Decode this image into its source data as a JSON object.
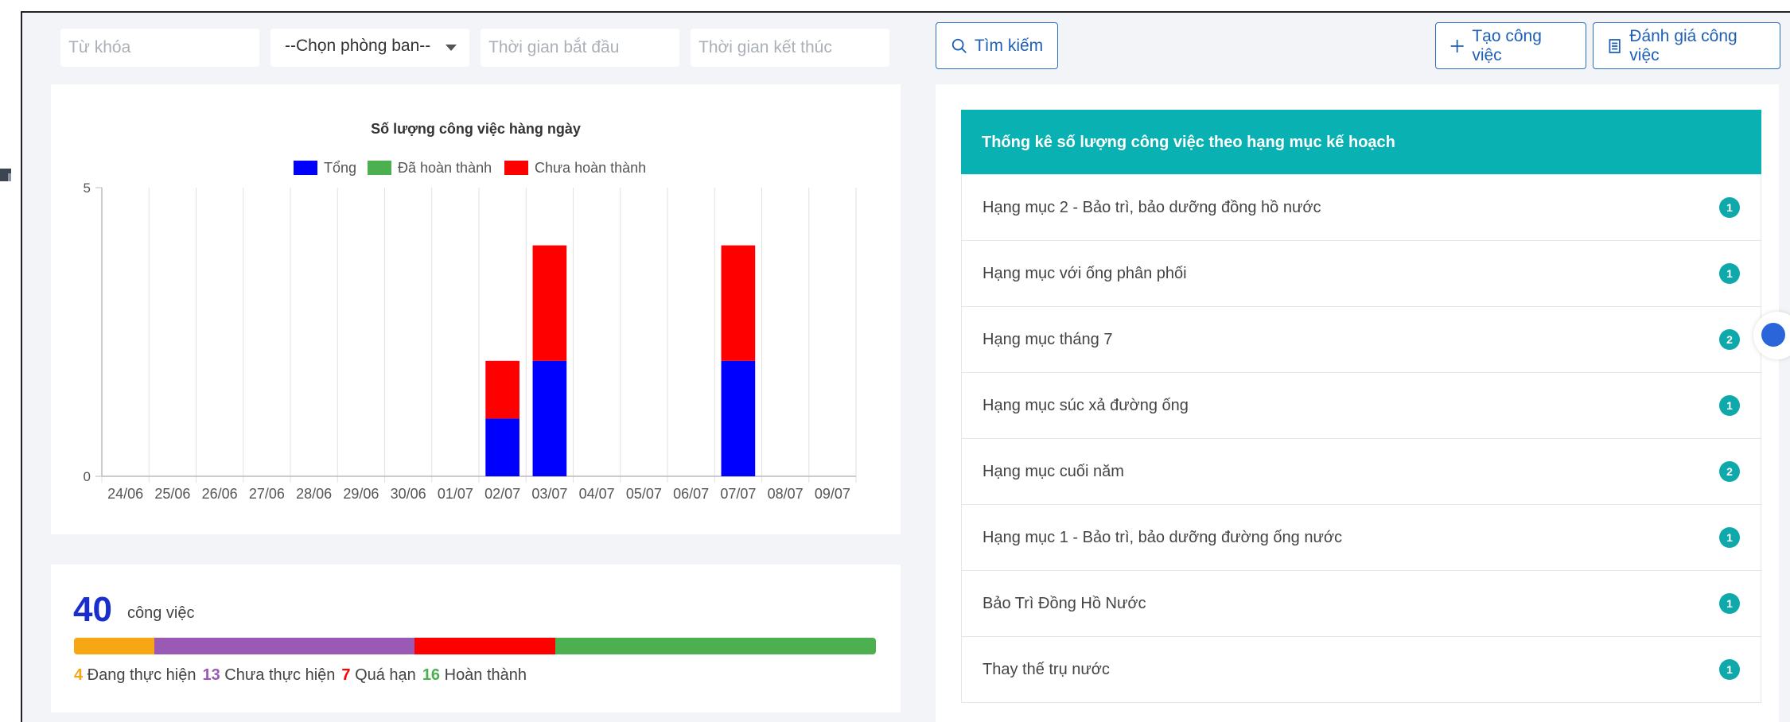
{
  "filters": {
    "keyword_placeholder": "Từ khóa",
    "department_value": "--Chọn phòng ban--",
    "start_placeholder": "Thời gian bắt đầu",
    "end_placeholder": "Thời gian kết thúc"
  },
  "toolbar": {
    "search_label": "Tìm kiếm",
    "create_label": "Tạo công việc",
    "evaluate_label": "Đánh giá công việc"
  },
  "colors": {
    "accent": "#2b6fc2",
    "teal": "#0ab1b3",
    "in_progress": "#f7a614",
    "not_started": "#9b59b6",
    "overdue": "#ff0000",
    "done": "#4caf50"
  },
  "chart_data": {
    "type": "bar",
    "title": "Số lượng công việc hàng ngày",
    "categories": [
      "24/06",
      "25/06",
      "26/06",
      "27/06",
      "28/06",
      "29/06",
      "30/06",
      "01/07",
      "02/07",
      "03/07",
      "04/07",
      "05/07",
      "06/07",
      "07/07",
      "08/07",
      "09/07"
    ],
    "series": [
      {
        "name": "Tổng",
        "color": "#0000ff",
        "values": [
          0,
          0,
          0,
          0,
          0,
          0,
          0,
          0,
          1,
          2,
          0,
          0,
          0,
          2,
          0,
          0
        ]
      },
      {
        "name": "Đã hoàn thành",
        "color": "#4caf50",
        "values": [
          0,
          0,
          0,
          0,
          0,
          0,
          0,
          0,
          0,
          0,
          0,
          0,
          0,
          0,
          0,
          0
        ]
      },
      {
        "name": "Chưa hoàn thành",
        "color": "#ff0000",
        "values": [
          0,
          0,
          0,
          0,
          0,
          0,
          0,
          0,
          1,
          2,
          0,
          0,
          0,
          2,
          0,
          0
        ]
      }
    ],
    "stacked": true,
    "ylim": [
      0,
      5
    ],
    "yticks": [
      "0",
      "5"
    ],
    "legend_position": "top",
    "grid": true
  },
  "summary": {
    "total": "40",
    "total_label": "công việc",
    "items": [
      {
        "count": 4,
        "label": "Đang thực hiện",
        "color": "#f7a614"
      },
      {
        "count": 13,
        "label": "Chưa thực hiện",
        "color": "#9b59b6"
      },
      {
        "count": 7,
        "label": "Quá hạn",
        "color": "#ff0000"
      },
      {
        "count": 16,
        "label": "Hoàn thành",
        "color": "#4caf50"
      }
    ]
  },
  "stats": {
    "title": "Thống kê số lượng công việc theo hạng mục kế hoạch",
    "items": [
      {
        "label": "Hạng mục 2 - Bảo trì, bảo dưỡng đồng hồ nước",
        "count": "1"
      },
      {
        "label": "Hạng mục với ống phân phối",
        "count": "1"
      },
      {
        "label": "Hạng mục tháng 7",
        "count": "2"
      },
      {
        "label": "Hạng mục súc xả đường ống",
        "count": "1"
      },
      {
        "label": "Hạng mục cuối năm",
        "count": "2"
      },
      {
        "label": "Hạng mục 1 - Bảo trì, bảo dưỡng đường ống nước",
        "count": "1"
      },
      {
        "label": "Bảo Trì Đồng Hồ Nước",
        "count": "1"
      },
      {
        "label": "Thay thế trụ nước",
        "count": "1"
      }
    ]
  }
}
